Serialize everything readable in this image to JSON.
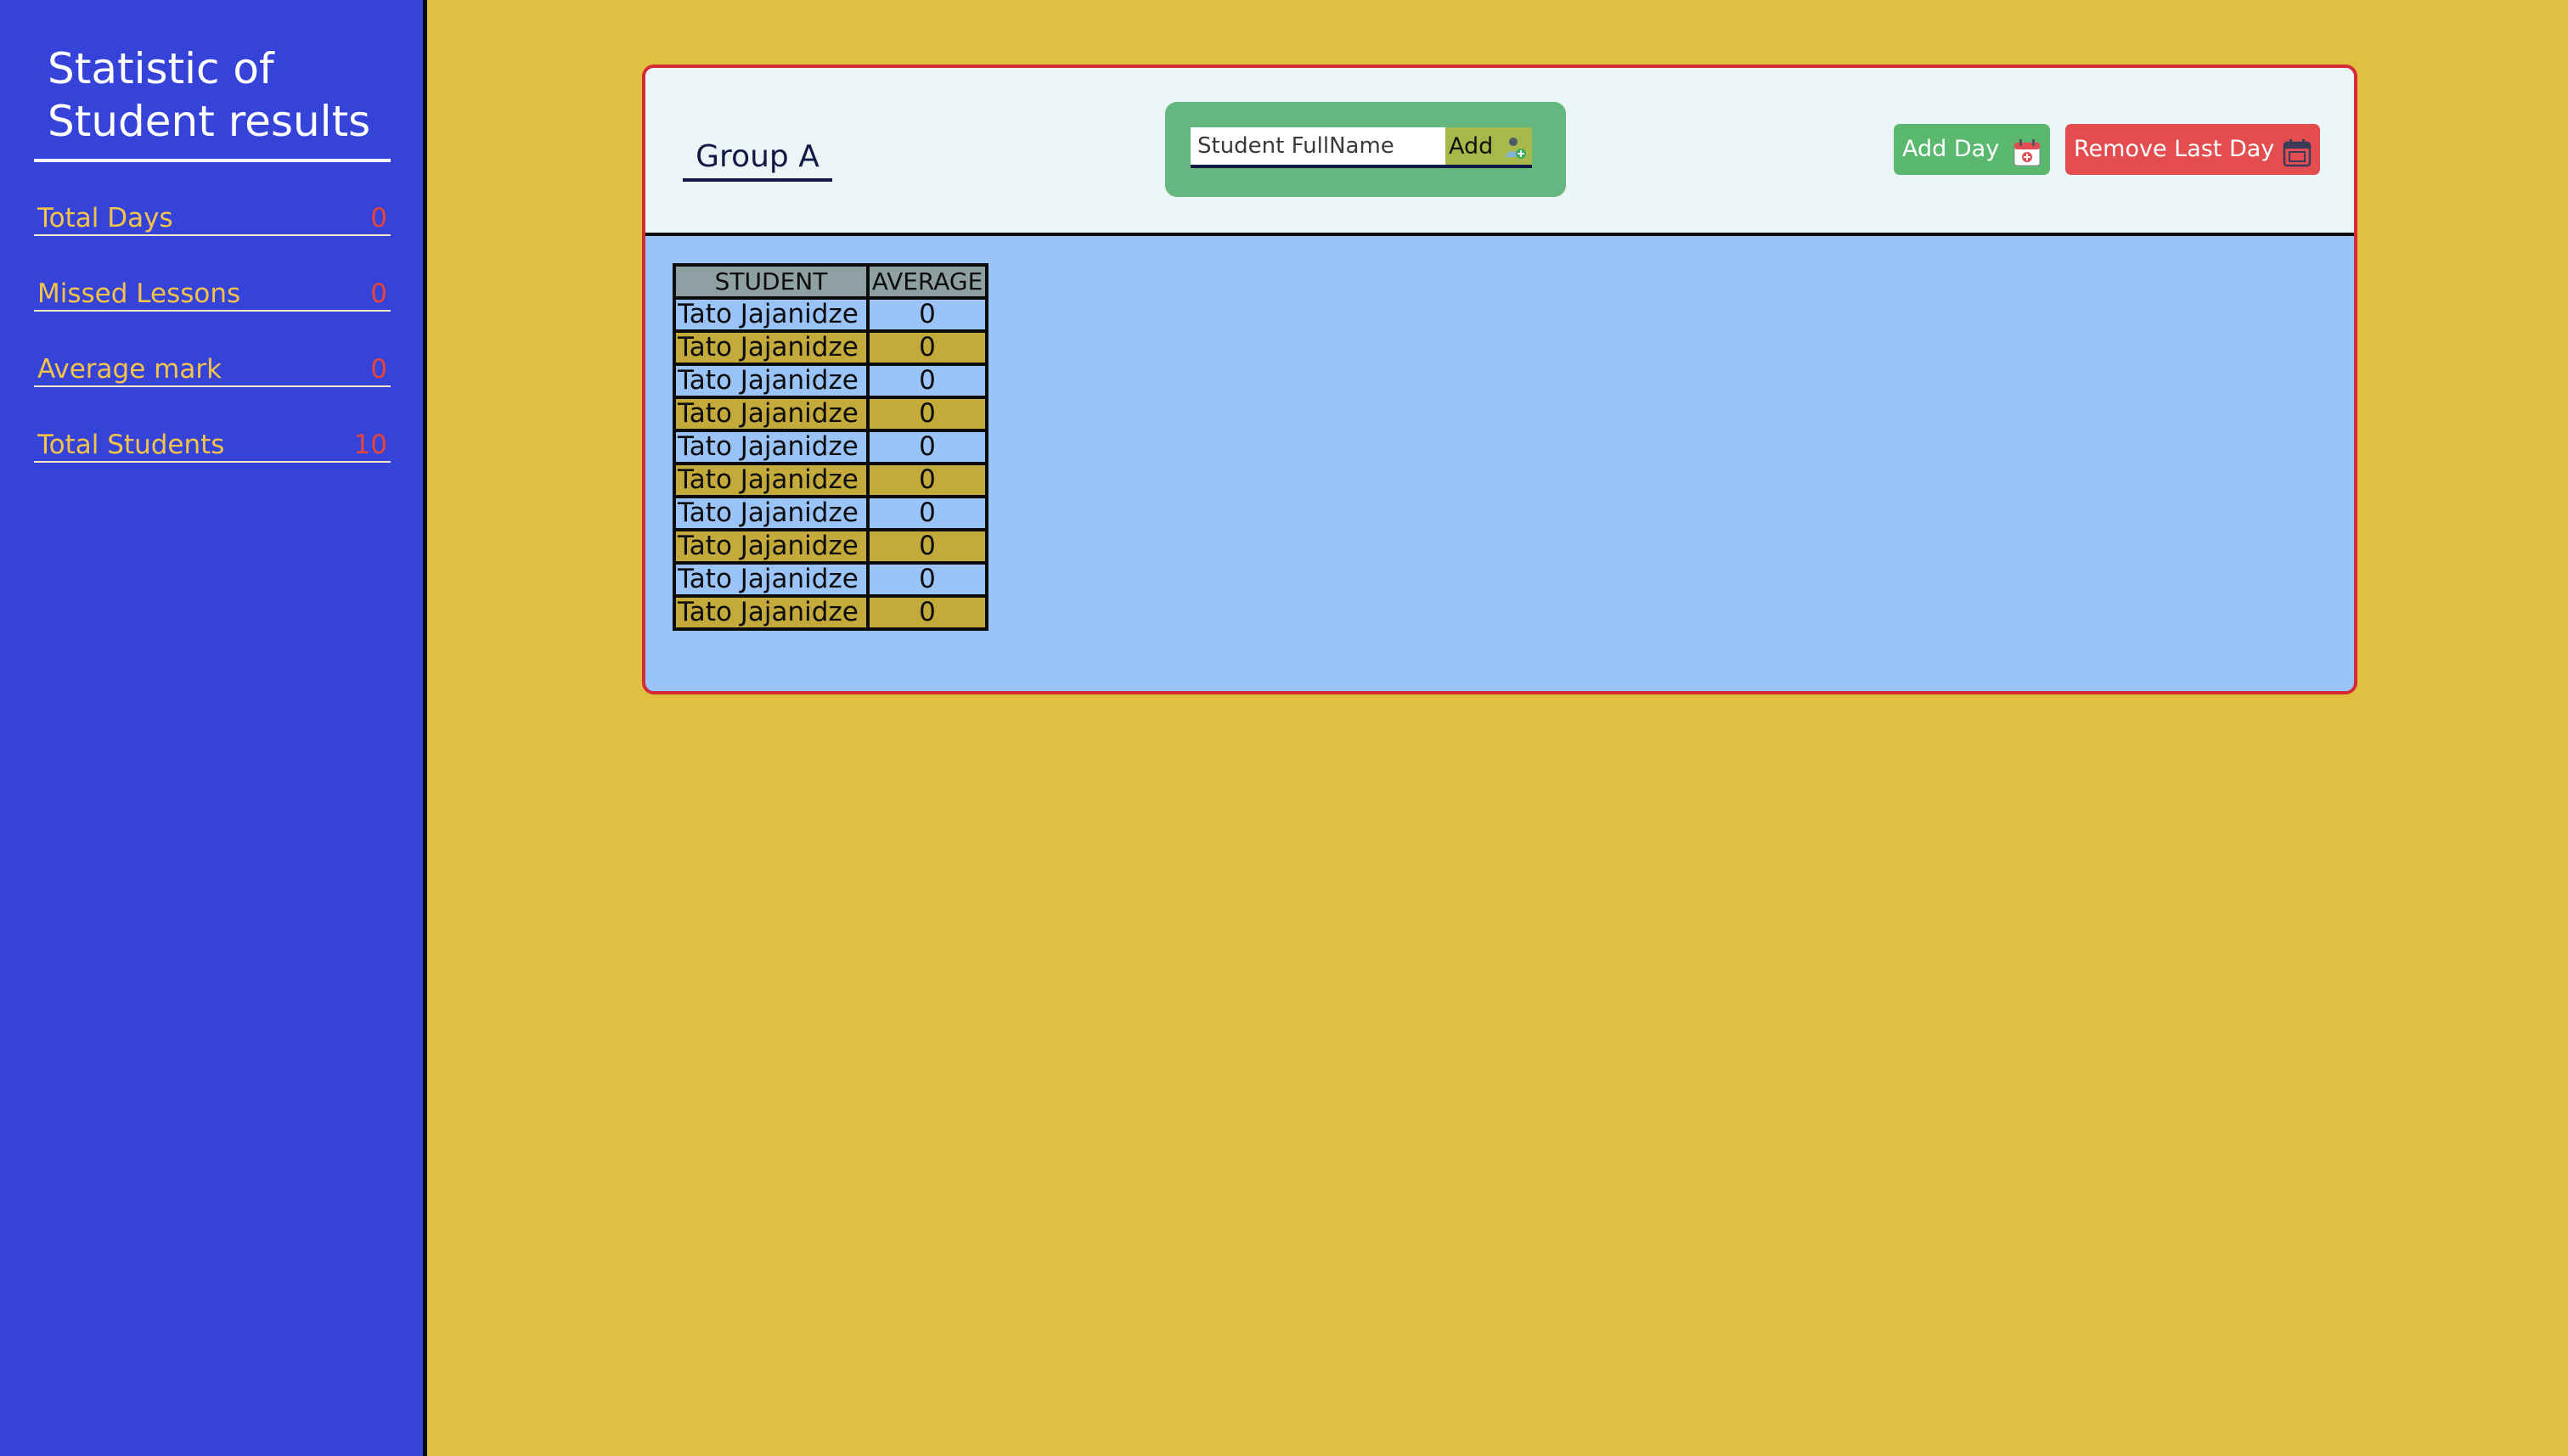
{
  "sidebar": {
    "title_line1": "Statistic of",
    "title_line2": "Student results",
    "stats": [
      {
        "label": "Total Days",
        "value": "0"
      },
      {
        "label": "Missed Lessons",
        "value": "0"
      },
      {
        "label": "Average mark",
        "value": "0"
      },
      {
        "label": "Total Students",
        "value": "10"
      }
    ]
  },
  "header": {
    "group_name": "Group A",
    "student_input": {
      "placeholder": "Student FullName",
      "value": ""
    },
    "add_student_label": "Add",
    "add_day_label": "Add Day",
    "remove_day_label": "Remove Last Day",
    "add_student_icon": "add-user-icon",
    "add_day_icon": "calendar-plus-icon",
    "remove_day_icon": "calendar-remove-icon"
  },
  "table": {
    "columns": [
      "STUDENT",
      "AVERAGE"
    ],
    "rows": [
      {
        "student": "Tato Jajanidze",
        "average": "0"
      },
      {
        "student": "Tato Jajanidze",
        "average": "0"
      },
      {
        "student": "Tato Jajanidze",
        "average": "0"
      },
      {
        "student": "Tato Jajanidze",
        "average": "0"
      },
      {
        "student": "Tato Jajanidze",
        "average": "0"
      },
      {
        "student": "Tato Jajanidze",
        "average": "0"
      },
      {
        "student": "Tato Jajanidze",
        "average": "0"
      },
      {
        "student": "Tato Jajanidze",
        "average": "0"
      },
      {
        "student": "Tato Jajanidze",
        "average": "0"
      },
      {
        "student": "Tato Jajanidze",
        "average": "0"
      }
    ]
  },
  "colors": {
    "page_background": "#e1bf40",
    "sidebar_background": "#3643d8",
    "card_border": "#d62b35",
    "add_day": "#5bb86f",
    "remove_day": "#e34d4f",
    "row_blue": "#9ac3f7",
    "row_gold": "#c4a93b"
  }
}
